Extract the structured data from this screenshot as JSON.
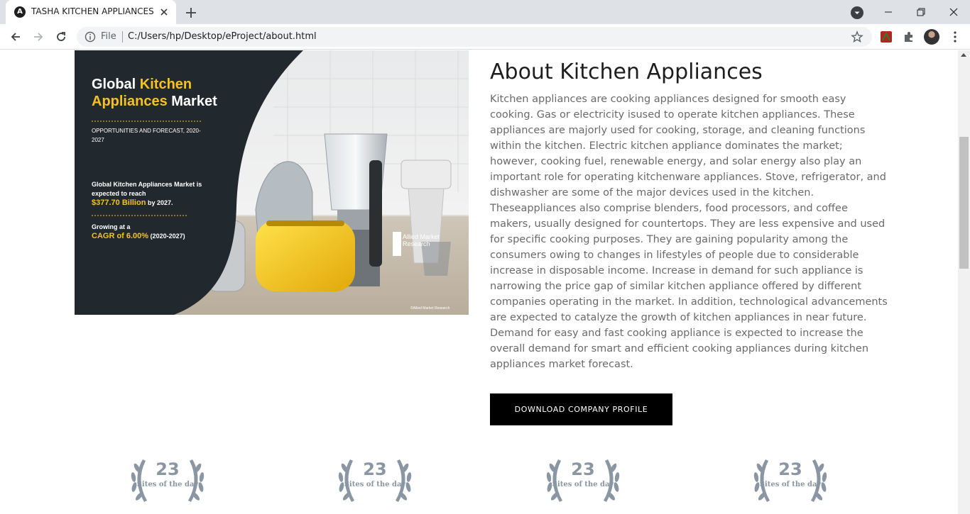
{
  "browser": {
    "tab": {
      "favicon_letter": "A",
      "title": "TASHA KITCHEN APPLIANCES"
    },
    "address": {
      "scheme_label": "File",
      "url": "C:/Users/hp/Desktop/eProject/about.html"
    }
  },
  "hero": {
    "title_global": "Global",
    "title_kitchen": "Kitchen",
    "title_appliances": "Appliances",
    "title_market": "Market",
    "subtitle": "OPPORTUNITIES AND FORECAST, 2020-2027",
    "body": "Global Kitchen Appliances Market is expected to reach",
    "value": "$377.70 Billion",
    "value_suffix": "by 2027.",
    "growing": "Growing at a",
    "cagr": "CAGR of 6.00%",
    "cagr_period": "(2020-2027)",
    "brand": "Allied Market Research",
    "copyright": "©Allied Market Research"
  },
  "about": {
    "title": "About Kitchen Appliances",
    "body": "Kitchen appliances are cooking appliances designed for smooth easy cooking. Gas or electricity isused to operate kitchen appliances. These appliances are majorly used for cooking, storage, and cleaning functions within the kitchen. Electric kitchen appliance dominates the market; however, cooking fuel, renewable energy, and solar energy also play an important role for operating kitchenware appliances. Stove, refrigerator, and dishwasher are some of the major devices used in the kitchen. Theseappliances also comprise blenders, food processors, and coffee makers, usually designed for countertops. They are less expensive and used for specific cooking purposes. They are gaining popularity among the consumers owing to changes in lifestyles of people due to considerable increase in disposable income. Increase in demand for such appliance is narrowing the price gap of similar kitchen appliance offered by different companies operating in the market. In addition, technological advancements are expected to catalyze the growth of kitchen appliances in near future. Demand for easy and fast cooking appliance is expected to increase the overall demand for smart and efficient cooking appliances during kitchen appliances market forecast.",
    "button_label": "DOWNLOAD COMPANY PROFILE"
  },
  "awards": [
    {
      "number": "23",
      "label": "Sites of the day"
    },
    {
      "number": "23",
      "label": "Sites of the day"
    },
    {
      "number": "23",
      "label": "Sites of the day"
    },
    {
      "number": "23",
      "label": "Sites of the day"
    }
  ],
  "colors": {
    "accent_yellow": "#f6c21d",
    "award_gray": "#8a96a3",
    "button_bg": "#000000"
  }
}
